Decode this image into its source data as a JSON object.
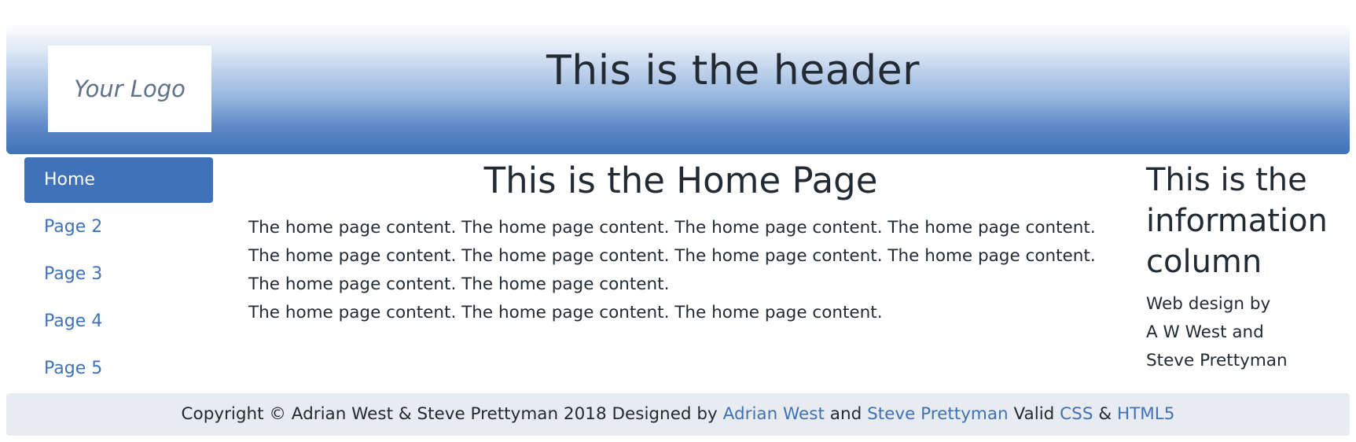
{
  "header": {
    "logo_text": "Your Logo",
    "title": "This is the header"
  },
  "nav": {
    "items": [
      {
        "label": "Home",
        "active": true
      },
      {
        "label": "Page 2",
        "active": false
      },
      {
        "label": "Page 3",
        "active": false
      },
      {
        "label": "Page 4",
        "active": false
      },
      {
        "label": "Page 5",
        "active": false
      }
    ]
  },
  "main": {
    "title": "This is the Home Page",
    "paragraphs": [
      "The home page content. The home page content. The home page content. The home page content. The home page content. The home page content. The home page content. The home page content. The home page content. The home page content.",
      "The home page content. The home page content. The home page content."
    ]
  },
  "info": {
    "title": "This is the information column",
    "lines": [
      "Web design by",
      "A W West and",
      "Steve Prettyman"
    ]
  },
  "footer": {
    "copyright": "Copyright © Adrian West & Steve Prettyman 2018 Designed by",
    "author1": "Adrian West",
    "and": "and",
    "author2": "Steve Prettyman",
    "valid": "Valid",
    "css_link": "CSS",
    "amp": "&",
    "html5_link": "HTML5"
  },
  "colors": {
    "accent": "#3f72b8",
    "text": "#222b33",
    "footer_bg": "#e8ebf0"
  }
}
